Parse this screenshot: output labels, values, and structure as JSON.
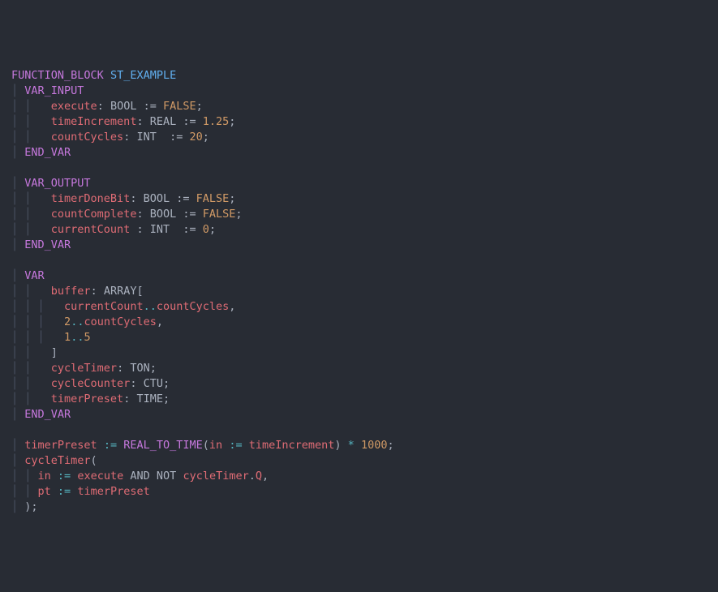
{
  "kw_function_block": "FUNCTION_BLOCK",
  "fb_name": "ST_EXAMPLE",
  "kw_var_input": "VAR_INPUT",
  "vi": [
    {
      "name": "execute",
      "type": "BOOL",
      "val": "FALSE",
      "valClass": "bool"
    },
    {
      "name": "timeIncrement",
      "type": "REAL",
      "val": "1.25",
      "valClass": "num"
    },
    {
      "name": "countCycles",
      "type": "INT",
      "val": "20",
      "valClass": "num"
    }
  ],
  "kw_end_var": "END_VAR",
  "kw_var_output": "VAR_OUTPUT",
  "vo": [
    {
      "name": "timerDoneBit",
      "type": "BOOL",
      "val": "FALSE",
      "valClass": "bool"
    },
    {
      "name": "countComplete",
      "type": "BOOL",
      "val": "FALSE",
      "valClass": "bool"
    },
    {
      "name": "currentCount",
      "type": "INT",
      "val": "0",
      "valClass": "num"
    }
  ],
  "kw_var": "VAR",
  "buffer_name": "buffer",
  "buffer_type": "ARRAY",
  "range1_from": "currentCount",
  "range1_to": "countCycles",
  "range2_from": "2",
  "range2_to": "countCycles",
  "range3_from": "1",
  "range3_to": "5",
  "cycleTimer_name": "cycleTimer",
  "cycleTimer_type": "TON",
  "cycleCounter_name": "cycleCounter",
  "cycleCounter_type": "CTU",
  "timerPreset_name": "timerPreset",
  "timerPreset_type": "TIME",
  "body": {
    "tp_lhs": "timerPreset",
    "assign_op": ":=",
    "cast_fn": "REAL_TO_TIME",
    "cast_arg": "in",
    "cast_rhs": "timeIncrement",
    "mul_op": "*",
    "thousand": "1000",
    "ct_call": "cycleTimer",
    "ct_in_lhs": "in",
    "ct_in_rhs_a": "execute",
    "ct_in_and": "AND",
    "ct_in_not": "NOT",
    "ct_in_rhs_b": "cycleTimer",
    "ct_in_rhs_member": "Q",
    "ct_pt_lhs": "pt",
    "ct_pt_rhs": "timerPreset"
  }
}
